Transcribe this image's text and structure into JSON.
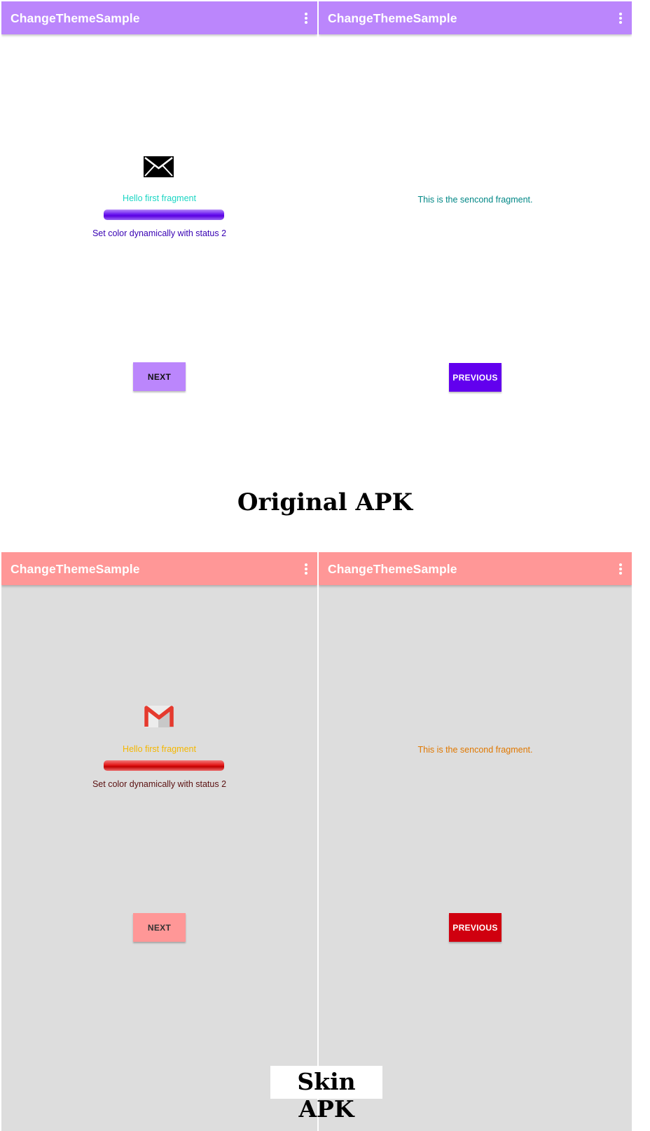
{
  "original": {
    "left_screen": {
      "app_title": "ChangeThemeSample",
      "hello_text": "Hello first fragment",
      "status_text": "Set color dynamically with status 2",
      "next_button": "NEXT",
      "icon": "envelope-icon"
    },
    "right_screen": {
      "app_title": "ChangeThemeSample",
      "fragment_text": "This is the sencond fragment.",
      "previous_button": "PREVIOUS"
    },
    "caption": "Original APK",
    "colors": {
      "appbar": "#bb86fc",
      "background": "#ffffff",
      "hello_text": "#1bd6c4",
      "progress": "#6200ee",
      "status_text": "#3700b3",
      "next_button": "#bb86fc",
      "previous_button": "#6200ee",
      "fragment_text": "#018786"
    }
  },
  "skin": {
    "left_screen": {
      "app_title": "ChangeThemeSample",
      "hello_text": "Hello first fragment",
      "status_text": "Set color dynamically with status 2",
      "next_button": "NEXT",
      "icon": "gmail-icon"
    },
    "right_screen": {
      "app_title": "ChangeThemeSample",
      "fragment_text": "This is the sencond fragment.",
      "previous_button": "PREVIOUS"
    },
    "caption": "Skin APK",
    "colors": {
      "appbar": "#ff9797",
      "background": "#dddddd",
      "hello_text": "#f5b700",
      "progress": "#e01a1a",
      "status_text": "#5a1010",
      "next_button": "#ff9797",
      "previous_button": "#d0000f",
      "fragment_text": "#e07800"
    }
  }
}
